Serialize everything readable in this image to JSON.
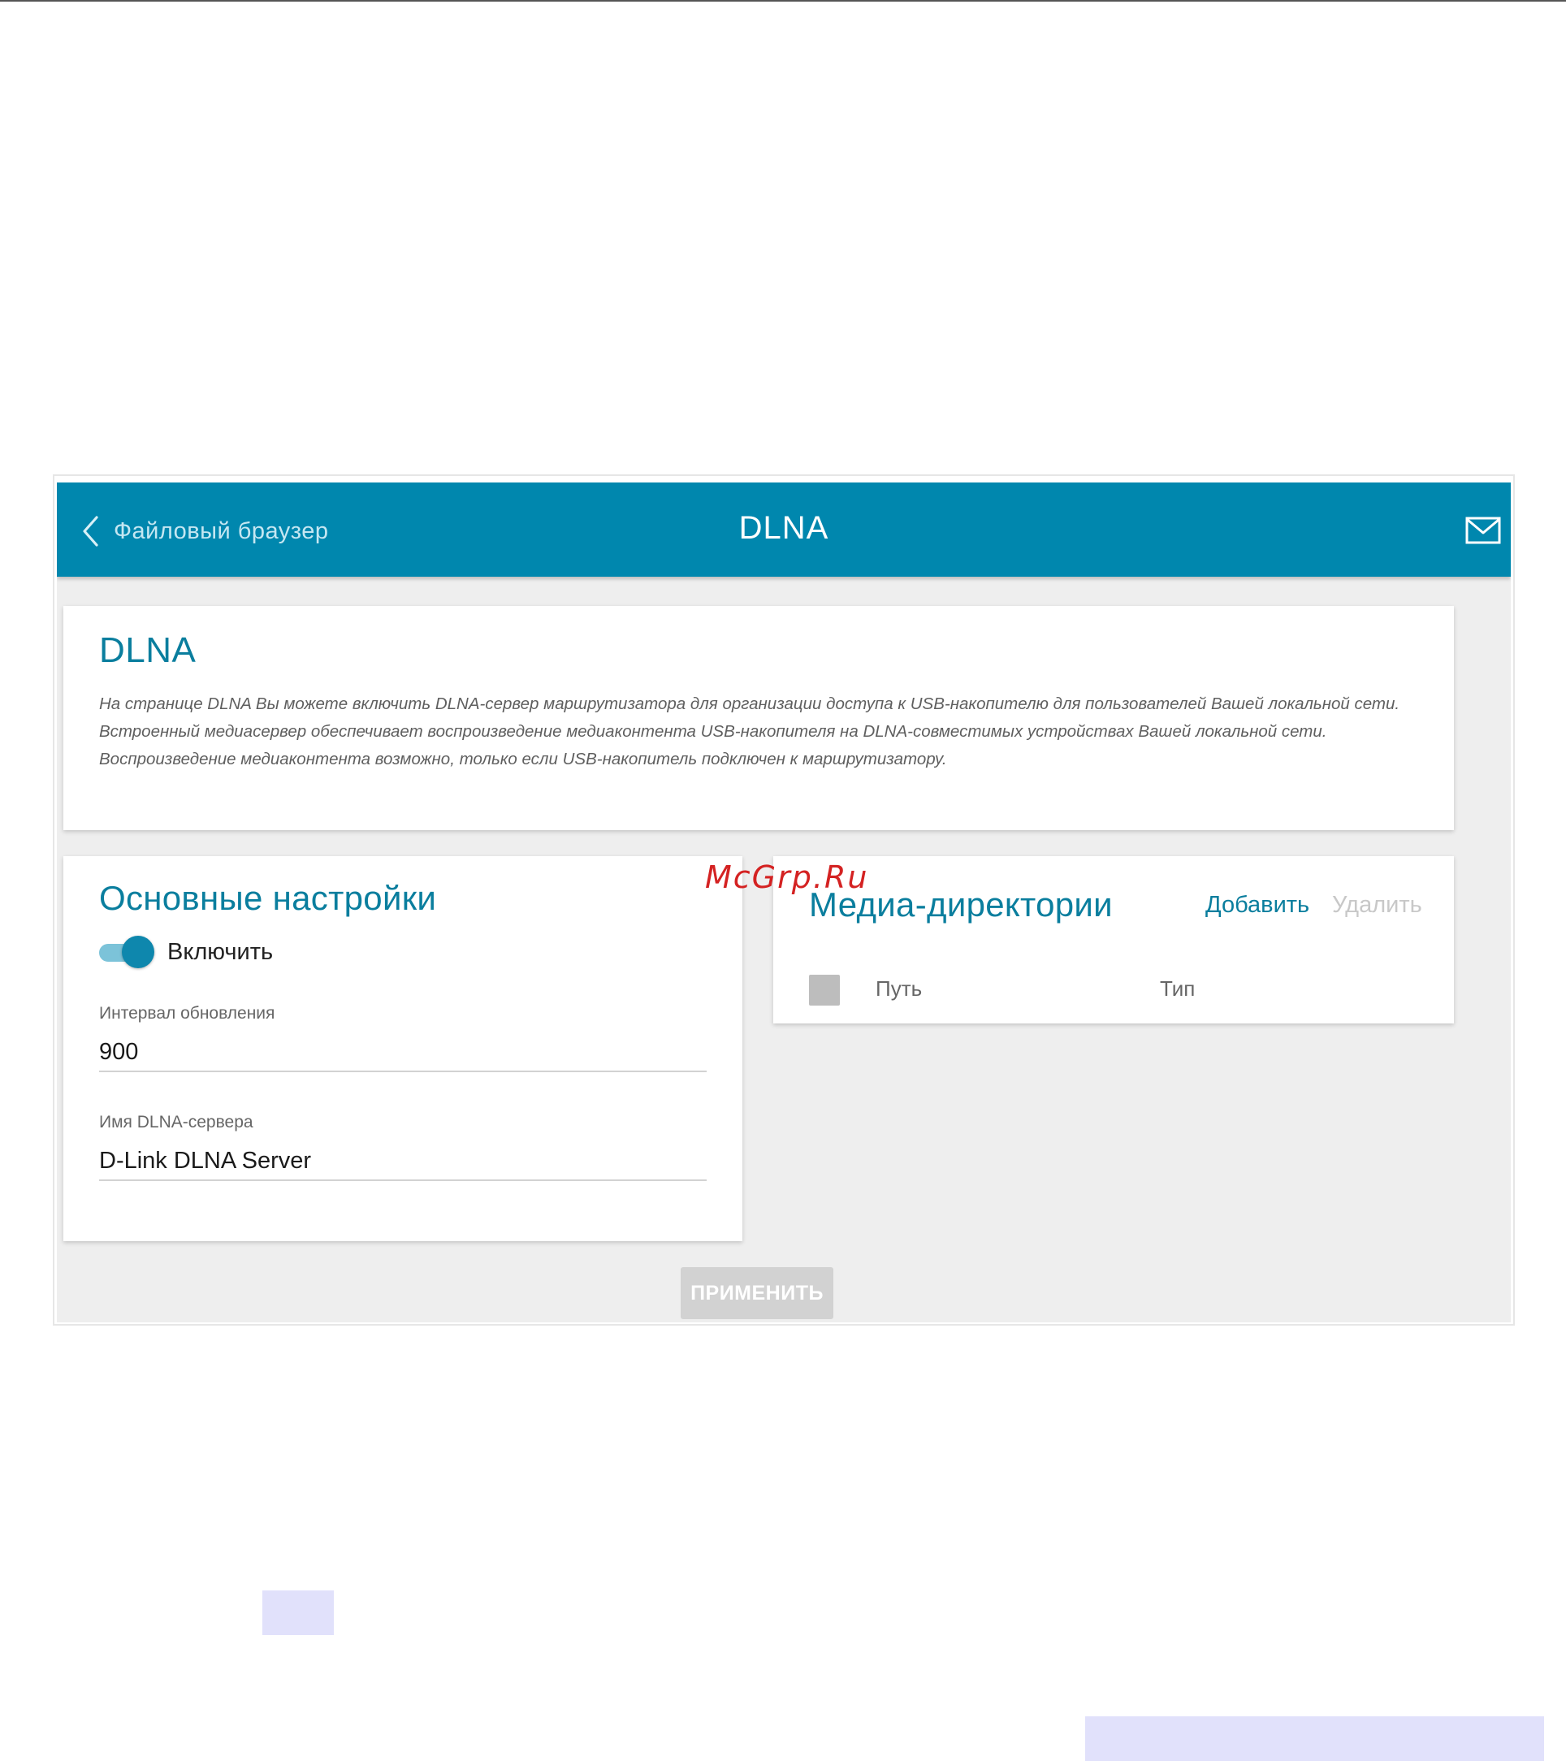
{
  "header": {
    "back_label": "Файловый браузер",
    "title": "DLNA",
    "back_icon": "chevron-left-icon",
    "mail_icon": "envelope-icon"
  },
  "intro": {
    "title": "DLNA",
    "lines": [
      "На странице DLNA Вы можете включить DLNA-сервер маршрутизатора для организации доступа к USB-накопителю для пользователей Вашей локальной сети.",
      "Встроенный медиасервер обеспечивает воспроизведение медиаконтента USB-накопителя на DLNA-совместимых устройствах Вашей локальной сети.",
      "Воспроизведение медиаконтента возможно, только если USB-накопитель подключен к маршрутизатору."
    ]
  },
  "basic": {
    "title": "Основные настройки",
    "enable_label": "Включить",
    "enabled": true,
    "interval_label": "Интервал обновления",
    "interval_value": "900",
    "server_name_label": "Имя DLNA-сервера",
    "server_name_value": "D-Link DLNA Server"
  },
  "media": {
    "title": "Медиа-директории",
    "add_label": "Добавить",
    "delete_label": "Удалить",
    "columns": [
      "Путь",
      "Тип"
    ]
  },
  "apply_label": "ПРИМЕНИТЬ",
  "watermark": "McGrp.Ru",
  "colors": {
    "header_bg": "#0087ae",
    "accent": "#0a7e9e",
    "panel_bg": "#eeeeee",
    "watermark": "#d42222"
  }
}
